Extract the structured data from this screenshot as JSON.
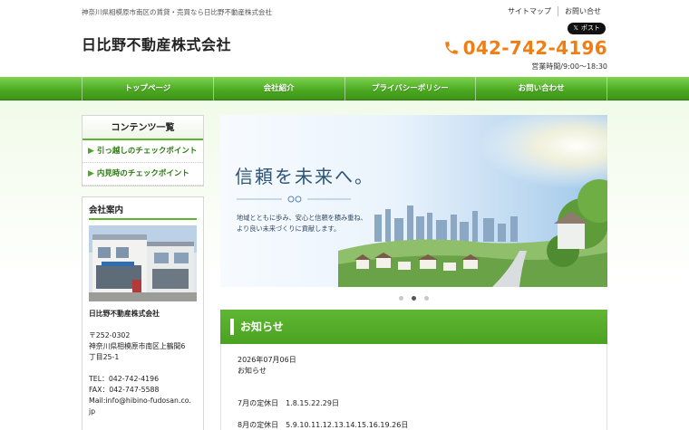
{
  "header": {
    "tagline": "神奈川県相模原市南区の賃貸・売買なら日比野不動産株式会社",
    "logo": "日比野不動産株式会社",
    "toplinks": [
      "サイトマップ",
      "お問い合せ"
    ],
    "xpost": "ポスト",
    "phone": "042-742-4196",
    "hours": "営業時間/9:00～18:30"
  },
  "nav": [
    "トップページ",
    "会社紹介",
    "プライバシーポリシー",
    "お問い合わせ"
  ],
  "sidebar": {
    "contents_title": "コンテンツ一覧",
    "contents_links": [
      "引っ越しのチェックポイント",
      "内見時のチェックポイント"
    ],
    "company_title": "会社案内",
    "company_name": "日比野不動産株式会社",
    "postal": "〒252-0302",
    "address1": "神奈川県相模原市南区上鶴間6",
    "address2": "丁目25-1",
    "tel": "TEL：042-742-4196",
    "fax": "FAX：042-747-5588",
    "mail1": "Mail:info@hibino-fudosan.co.",
    "mail2": "jp"
  },
  "hero": {
    "headline": "信頼を未来へ。",
    "line1": "地域とともに歩み、安心と信頼を積み重ね、",
    "line2": "より良い未来づくりに貢献します。",
    "slides": 3,
    "active_slide": 2
  },
  "news": {
    "title": "お知らせ",
    "date": "2026年07月06日",
    "heading": "お知らせ",
    "line1": "7月の定休日　1.8.15.22.29日",
    "line2": "8月の定休日　5.9.10.11.12.13.14.15.16.19.26日"
  },
  "colors": {
    "nav_green": "#4aa820",
    "phone_orange": "#ef7e14",
    "link_green": "#2c7a12"
  }
}
